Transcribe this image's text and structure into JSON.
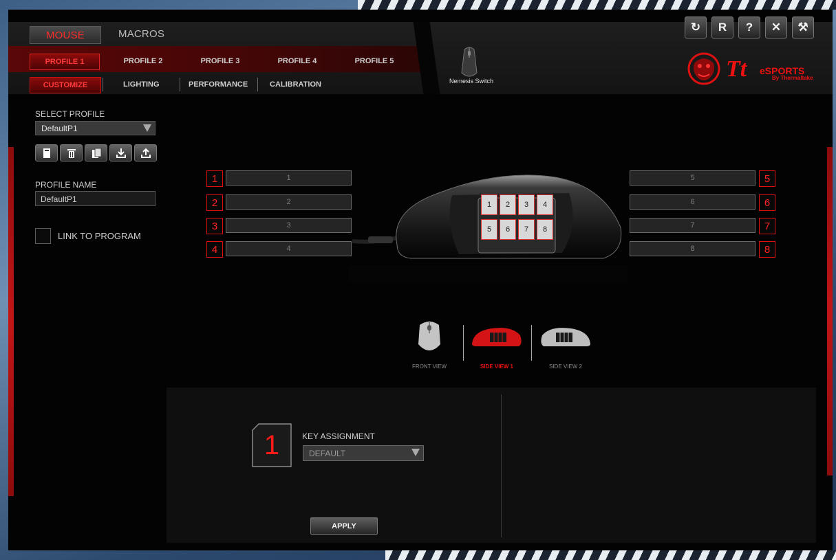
{
  "nav": {
    "main_tabs": [
      {
        "label": "MOUSE",
        "active": true
      },
      {
        "label": "MACROS",
        "active": false
      }
    ],
    "profile_tabs": [
      {
        "label": "PROFILE 1",
        "active": true
      },
      {
        "label": "PROFILE 2",
        "active": false
      },
      {
        "label": "PROFILE 3",
        "active": false
      },
      {
        "label": "PROFILE 4",
        "active": false
      },
      {
        "label": "PROFILE 5",
        "active": false
      }
    ],
    "sub_tabs": [
      {
        "label": "CUSTOMIZE",
        "active": true
      },
      {
        "label": "LIGHTING",
        "active": false
      },
      {
        "label": "PERFORMANCE",
        "active": false
      },
      {
        "label": "CALIBRATION",
        "active": false
      }
    ]
  },
  "device": {
    "name": "Nemesis Switch"
  },
  "window_buttons": [
    "refresh-icon",
    "reset-icon",
    "help-icon",
    "close-icon",
    "settings-tools-icon"
  ],
  "window_button_glyphs": {
    "refresh": "↻",
    "reset": "R",
    "help": "?",
    "close": "✕",
    "settings": "⚒"
  },
  "brand": {
    "logo_main": "Tt",
    "logo_sub": "eSPORTS",
    "logo_by": "By Thermaltake"
  },
  "left_panel": {
    "select_profile_label": "SELECT PROFILE",
    "selected_profile": "DefaultP1",
    "profile_actions": [
      "new-profile-icon",
      "delete-profile-icon",
      "copy-profile-icon",
      "import-profile-icon",
      "export-profile-icon"
    ],
    "profile_name_label": "PROFILE NAME",
    "profile_name_value": "DefaultP1",
    "link_to_program_label": "LINK TO PROGRAM",
    "link_to_program_checked": false
  },
  "buttons_left": [
    {
      "num": "1",
      "value": "1"
    },
    {
      "num": "2",
      "value": "2"
    },
    {
      "num": "3",
      "value": "3"
    },
    {
      "num": "4",
      "value": "4"
    }
  ],
  "buttons_right": [
    {
      "num": "5",
      "value": "5"
    },
    {
      "num": "6",
      "value": "6"
    },
    {
      "num": "7",
      "value": "7"
    },
    {
      "num": "8",
      "value": "8"
    }
  ],
  "side_keys": [
    "1",
    "2",
    "3",
    "4",
    "5",
    "6",
    "7",
    "8"
  ],
  "views": [
    {
      "label": "FRONT VIEW",
      "active": false
    },
    {
      "label": "SIDE VIEW 1",
      "active": true
    },
    {
      "label": "SIDE VIEW 2",
      "active": false
    }
  ],
  "assignment": {
    "selected_key": "1",
    "label": "KEY ASSIGNMENT",
    "value": "DEFAULT",
    "apply_label": "APPLY"
  },
  "colors": {
    "accent_red": "#ff2222",
    "dark_red": "#5a0707",
    "panel": "#0f0f0f"
  }
}
